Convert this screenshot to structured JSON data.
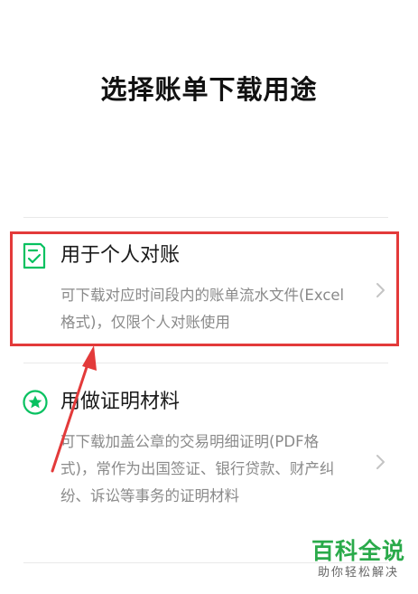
{
  "page_title": "选择账单下载用途",
  "options": [
    {
      "title": "用于个人对账",
      "description": "可下载对应时间段内的账单流水文件(Excel格式)，仅限个人对账使用",
      "icon": "document-check-icon"
    },
    {
      "title": "用做证明材料",
      "description": "可下载加盖公章的交易明细证明(PDF格式)，常作为出国签证、银行贷款、财产纠纷、诉讼等事务的证明材料",
      "icon": "star-badge-icon"
    }
  ],
  "watermark": {
    "main": "百科全说",
    "sub": "助你轻松解决"
  },
  "colors": {
    "accent": "#07c160",
    "highlight": "#e33a3a",
    "watermark": "#2aaa4a"
  }
}
